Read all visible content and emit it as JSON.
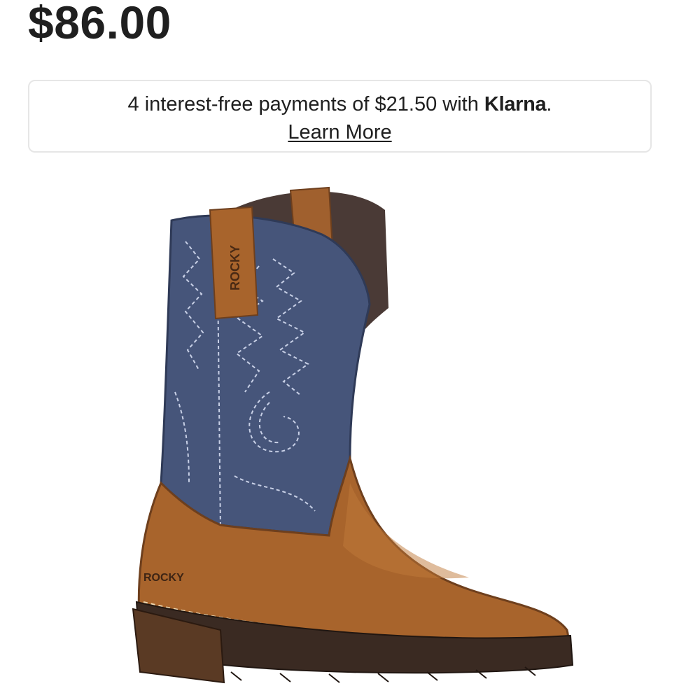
{
  "price": "$86.00",
  "klarna": {
    "message_prefix": "4 interest-free payments of $21.50 with ",
    "brand": "Klarna",
    "message_suffix": ".",
    "learn_more": "Learn More"
  },
  "product_image": {
    "alt": "Brown and navy western boot",
    "brand_mark": "ROCKY",
    "colors": {
      "upper": "#46557a",
      "leather": "#a8642c",
      "sole": "#3a2a22"
    }
  }
}
